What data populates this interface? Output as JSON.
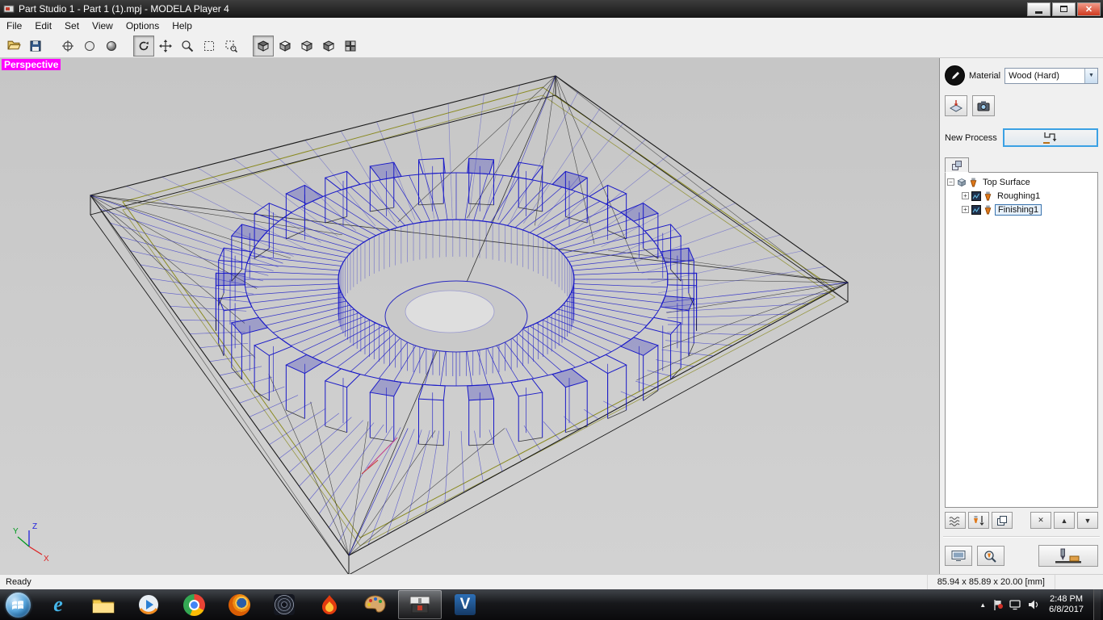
{
  "window": {
    "title": "Part Studio 1 - Part 1 (1).mpj - MODELA Player 4"
  },
  "menu": {
    "items": [
      "File",
      "Edit",
      "Set",
      "View",
      "Options",
      "Help"
    ]
  },
  "viewport": {
    "label": "Perspective",
    "axis": {
      "x": "X",
      "y": "Y",
      "z": "Z"
    }
  },
  "panel": {
    "material_label": "Material",
    "material_value": "Wood (Hard)",
    "new_process_label": "New Process",
    "tree": {
      "root": "Top Surface",
      "children": [
        "Roughing1",
        "Finishing1"
      ]
    }
  },
  "statusbar": {
    "status": "Ready",
    "dimensions": "85.94 x 85.89 x 20.00 [mm]"
  },
  "taskbar": {
    "time": "2:48 PM",
    "date": "6/8/2017"
  },
  "icons": {
    "plus": "+",
    "minus": "−",
    "delete": "✕",
    "up": "▲",
    "down": "▼",
    "chevron": "▲",
    "dropdown": "▼",
    "close": "✕",
    "v_app": "V",
    "ie": "e"
  },
  "colors": {
    "accent": "#3ba1e4",
    "toolpath_blue": "#1a1ac8",
    "stock_olive": "#8a8a20",
    "label_magenta": "#ff00ff"
  }
}
